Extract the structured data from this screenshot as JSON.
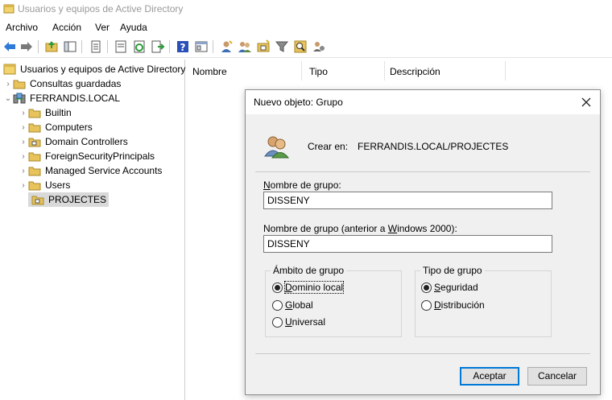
{
  "window": {
    "title": "Usuarios y equipos de Active Directory"
  },
  "menu": [
    "Archivo",
    "Acción",
    "Ver",
    "Ayuda"
  ],
  "toolbar_icons": [
    "back-arrow-icon",
    "forward-arrow-icon",
    "up-folder-icon",
    "show-hide-tree-icon",
    "copy-icon",
    "properties-icon",
    "refresh-icon",
    "export-list-icon",
    "help-icon",
    "console-icon",
    "new-user-icon",
    "new-group-icon",
    "new-ou-icon",
    "filter-icon",
    "find-icon",
    "add-to-group-icon"
  ],
  "tree": {
    "root": "Usuarios y equipos de Active Directory",
    "saved_queries": "Consultas guardadas",
    "domain": "FERRANDIS.LOCAL",
    "children": [
      "Builtin",
      "Computers",
      "Domain Controllers",
      "ForeignSecurityPrincipals",
      "Managed Service Accounts",
      "Users",
      "PROJECTES"
    ]
  },
  "columns": [
    "Nombre",
    "Tipo",
    "Descripción"
  ],
  "dialog": {
    "title": "Nuevo objeto: Grupo",
    "create_in_label": "Crear en:",
    "create_in_value": "FERRANDIS.LOCAL/PROJECTES",
    "group_name_label_pre": "",
    "group_name_label_u": "N",
    "group_name_label_post": "ombre de grupo:",
    "group_name_value": "DISSENY",
    "legacy_name_label_pre": "Nombre de grupo (anterior a ",
    "legacy_name_label_u": "W",
    "legacy_name_label_post": "indows 2000):",
    "legacy_name_value": "DISSENY",
    "scope": {
      "title": "Ámbito de grupo",
      "options": [
        {
          "u": "D",
          "rest": "ominio local",
          "selected": true
        },
        {
          "u": "G",
          "rest": "lobal",
          "selected": false
        },
        {
          "u": "U",
          "rest": "niversal",
          "selected": false
        }
      ]
    },
    "type": {
      "title": "Tipo de grupo",
      "options": [
        {
          "u": "S",
          "rest": "eguridad",
          "selected": true
        },
        {
          "u": "D",
          "rest": "istribución",
          "selected": false
        }
      ]
    },
    "ok_label": "Aceptar",
    "cancel_label": "Cancelar"
  },
  "colors": {
    "accent": "#0078d7",
    "folder": "#e8c25a",
    "selection": "#d9d9d9"
  }
}
